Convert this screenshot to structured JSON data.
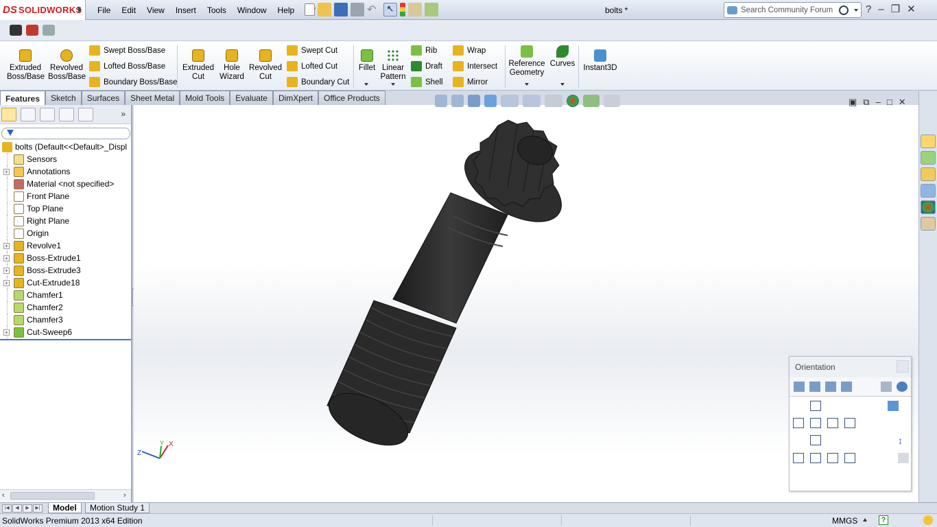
{
  "app": {
    "brand": "SOLIDWORKS",
    "brand_ds": "DS",
    "doc_title": "bolts *"
  },
  "menu": [
    "File",
    "Edit",
    "View",
    "Insert",
    "Tools",
    "Window",
    "Help"
  ],
  "search": {
    "placeholder": "Search Community Forum"
  },
  "command_manager": {
    "big_buttons": [
      {
        "id": "extruded-boss",
        "label": "Extruded Boss/Base",
        "line1": "Extruded",
        "line2": "Boss/Base",
        "icon": "extrude-icon",
        "color": "#e7b420"
      },
      {
        "id": "revolved-boss",
        "label": "Revolved Boss/Base",
        "line1": "Revolved",
        "line2": "Boss/Base",
        "icon": "revolve-icon",
        "color": "#e7b420"
      },
      {
        "id": "extruded-cut",
        "label": "Extruded Cut",
        "line1": "Extruded",
        "line2": "Cut",
        "icon": "extrude-cut-icon",
        "color": "#e7b420"
      },
      {
        "id": "hole-wizard",
        "label": "Hole Wizard",
        "line1": "Hole",
        "line2": "Wizard",
        "icon": "hole-wizard-icon",
        "color": "#e7b420"
      },
      {
        "id": "revolved-cut",
        "label": "Revolved Cut",
        "line1": "Revolved",
        "line2": "Cut",
        "icon": "revolve-cut-icon",
        "color": "#e7b420"
      },
      {
        "id": "fillet",
        "label": "Fillet",
        "line1": "Fillet",
        "line2": "",
        "icon": "fillet-icon",
        "color": "#7ac143"
      },
      {
        "id": "linear-pattern",
        "label": "Linear Pattern",
        "line1": "Linear",
        "line2": "Pattern",
        "icon": "linear-pattern-icon",
        "color": "#2f8a2f"
      },
      {
        "id": "reference-geometry",
        "label": "Reference Geometry",
        "line1": "Reference",
        "line2": "Geometry",
        "icon": "reference-geometry-icon",
        "color": "#7ac143"
      },
      {
        "id": "curves",
        "label": "Curves",
        "line1": "Curves",
        "line2": "",
        "icon": "curves-icon",
        "color": "#2f8a2f"
      },
      {
        "id": "instant3d",
        "label": "Instant3D",
        "line1": "Instant3D",
        "line2": "",
        "icon": "instant3d-icon",
        "color": "#4a90d0"
      }
    ],
    "small_buttons": {
      "col1": [
        "Swept Boss/Base",
        "Lofted Boss/Base",
        "Boundary Boss/Base"
      ],
      "col2": [
        "Swept Cut",
        "Lofted Cut",
        "Boundary Cut"
      ],
      "col3": [
        "Rib",
        "Draft",
        "Shell"
      ],
      "col4": [
        "Wrap",
        "Intersect",
        "Mirror"
      ]
    }
  },
  "tabs": [
    "Features",
    "Sketch",
    "Surfaces",
    "Sheet Metal",
    "Mold Tools",
    "Evaluate",
    "DimXpert",
    "Office Products"
  ],
  "active_tab": "Features",
  "feature_tree": {
    "root": "bolts  (Default<<Default>_Displ",
    "items": [
      {
        "label": "Sensors",
        "icon": "sensor-icon",
        "expandable": false
      },
      {
        "label": "Annotations",
        "icon": "annotations-icon",
        "expandable": true
      },
      {
        "label": "Material <not specified>",
        "icon": "material-icon",
        "expandable": false
      },
      {
        "label": "Front Plane",
        "icon": "plane-icon",
        "expandable": false
      },
      {
        "label": "Top Plane",
        "icon": "plane-icon",
        "expandable": false
      },
      {
        "label": "Right Plane",
        "icon": "plane-icon",
        "expandable": false
      },
      {
        "label": "Origin",
        "icon": "origin-icon",
        "expandable": false
      },
      {
        "label": "Revolve1",
        "icon": "revolve-icon",
        "expandable": true
      },
      {
        "label": "Boss-Extrude1",
        "icon": "extrude-icon",
        "expandable": true
      },
      {
        "label": "Boss-Extrude3",
        "icon": "extrude-icon",
        "expandable": true
      },
      {
        "label": "Cut-Extrude18",
        "icon": "extrude-cut-icon",
        "expandable": true
      },
      {
        "label": "Chamfer1",
        "icon": "chamfer-icon",
        "expandable": false
      },
      {
        "label": "Chamfer2",
        "icon": "chamfer-icon",
        "expandable": false
      },
      {
        "label": "Chamfer3",
        "icon": "chamfer-icon",
        "expandable": false
      },
      {
        "label": "Cut-Sweep6",
        "icon": "sweep-cut-icon",
        "expandable": true
      }
    ]
  },
  "orientation": {
    "title": "Orientation"
  },
  "triad": {
    "x": "X",
    "y": "Y",
    "z": "Z"
  },
  "bottom_tabs": [
    "Model",
    "Motion Study 1"
  ],
  "status": {
    "edition": "SolidWorks Premium 2013 x64 Edition",
    "units": "MMGS",
    "help": "?"
  },
  "colors": {
    "accent": "#3e74c4",
    "brand_red": "#d31a1a",
    "bolt": "#2b2b2b"
  }
}
